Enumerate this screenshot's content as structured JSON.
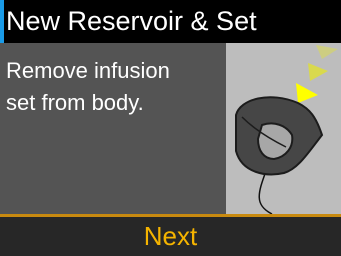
{
  "header": {
    "title": "New Reservoir & Set",
    "accent_color": "#1a9be8"
  },
  "main": {
    "instruction_lines": [
      "Remove infusion",
      "set from body."
    ],
    "illustration_icon": "infusion-set-removal-icon"
  },
  "footer": {
    "next_label": "Next",
    "label_color": "#f5b400"
  }
}
